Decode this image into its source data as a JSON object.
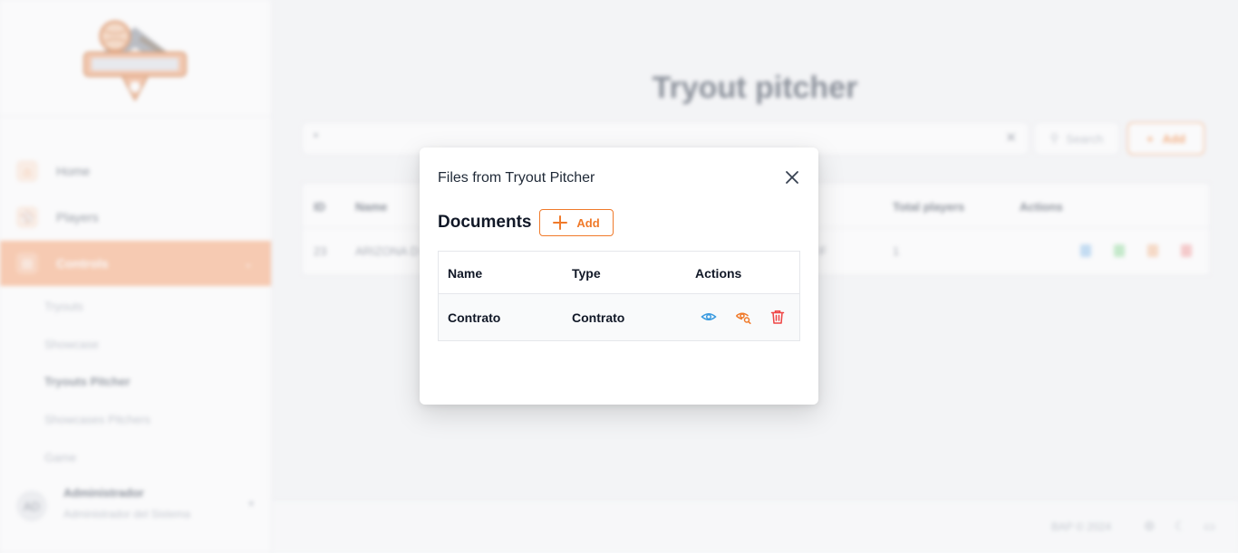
{
  "sidebar": {
    "nav": [
      {
        "label": "Home",
        "icon": "home-icon"
      },
      {
        "label": "Players",
        "icon": "players-icon"
      },
      {
        "label": "Controls",
        "icon": "controls-icon",
        "active": true
      }
    ],
    "sub": [
      {
        "label": "Tryouts"
      },
      {
        "label": "Showcase"
      },
      {
        "label": "Tryouts Pitcher",
        "current": true
      },
      {
        "label": "Showcases Pitchers"
      },
      {
        "label": "Game"
      }
    ],
    "user": {
      "initials": "AD",
      "name": "Administrador",
      "role": "Administrador del Sistema"
    }
  },
  "main": {
    "title": "Tryout pitcher",
    "search": {
      "value": "*",
      "button_label": "Search"
    },
    "add_label": "Add",
    "table": {
      "headers": [
        "ID",
        "Name",
        "Total players",
        "Actions"
      ],
      "row": {
        "id": "23",
        "name": "ARIZONA D",
        "extra": "F",
        "total_players": "1"
      }
    }
  },
  "footer": {
    "copyright": "BAP © 2024"
  },
  "modal": {
    "title": "Files from Tryout Pitcher",
    "section_title": "Documents",
    "add_label": "Add",
    "table": {
      "headers": [
        "Name",
        "Type",
        "Actions"
      ],
      "rows": [
        {
          "name": "Contrato",
          "type": "Contrato"
        }
      ]
    }
  },
  "colors": {
    "accent": "#f07a2a",
    "view": "#3b9be0",
    "delete": "#ef4444"
  }
}
